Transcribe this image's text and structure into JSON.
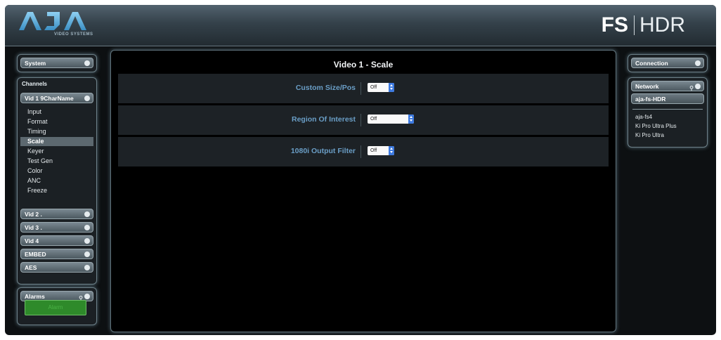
{
  "header": {
    "logo_text": "AJA",
    "logo_subtext": "VIDEO SYSTEMS",
    "product_fs": "FS",
    "product_hdr": "HDR"
  },
  "left": {
    "system": {
      "label": "System"
    },
    "channels": {
      "label": "Channels",
      "selected_channel": "Vid 1 9CharName",
      "items": [
        "Input",
        "Format",
        "Timing",
        "Scale",
        "Keyer",
        "Test Gen",
        "Color",
        "ANC",
        "Freeze"
      ],
      "active_item": "Scale"
    },
    "other_channels": [
      "Vid 2 .",
      "Vid 3 .",
      "Vid 4",
      "EMBED",
      "AES"
    ],
    "alarms": {
      "label": "Alarms",
      "indicator": "Alarm"
    }
  },
  "main": {
    "title": "Video 1 - Scale",
    "rows": [
      {
        "label": "Custom Size/Pos",
        "value": "Off"
      },
      {
        "label": "Region Of Interest",
        "value": "Off"
      },
      {
        "label": "1080i Output Filter",
        "value": "Off"
      }
    ]
  },
  "right": {
    "connection": {
      "label": "Connection"
    },
    "network": {
      "label": "Network",
      "current": "aja-fs-HDR",
      "devices": [
        "aja-fs4",
        "Ki Pro Ultra Plus",
        "Ki Pro Ultra"
      ]
    }
  },
  "colors": {
    "accent_label": "#6a9ec6",
    "select_arrow": "#3d7ae0",
    "alarm_green": "#2e8a2a"
  }
}
